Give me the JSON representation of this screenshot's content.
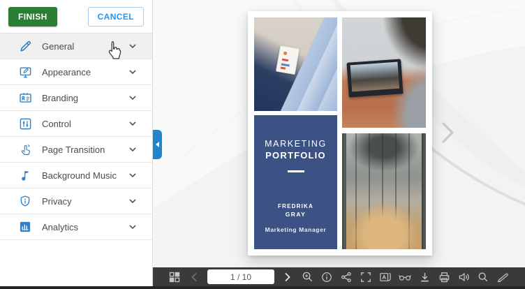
{
  "header": {
    "finish_label": "FINISH",
    "cancel_label": "CANCEL"
  },
  "sidebar": {
    "items": [
      {
        "label": "General",
        "icon": "pencil-icon",
        "active": true
      },
      {
        "label": "Appearance",
        "icon": "monitor-edit-icon",
        "active": false
      },
      {
        "label": "Branding",
        "icon": "id-card-icon",
        "active": false
      },
      {
        "label": "Control",
        "icon": "sliders-icon",
        "active": false
      },
      {
        "label": "Page Transition",
        "icon": "tap-gesture-icon",
        "active": false
      },
      {
        "label": "Background Music",
        "icon": "music-note-icon",
        "active": false
      },
      {
        "label": "Privacy",
        "icon": "shield-info-icon",
        "active": false
      },
      {
        "label": "Analytics",
        "icon": "bar-chart-icon",
        "active": false
      }
    ]
  },
  "viewer": {
    "cover": {
      "title_line1": "MARKETING",
      "title_line2": "PORTFOLIO",
      "author_first": "FREDRIKA",
      "author_last": "GRAY",
      "author_role": "Marketing Manager"
    }
  },
  "toolbar": {
    "page_indicator": "1 / 10",
    "icons": [
      "thumbnails-icon",
      "prev-page-icon",
      "next-page-icon",
      "zoom-in-icon",
      "info-icon",
      "share-icon",
      "fullscreen-icon",
      "text-book-icon",
      "glasses-icon",
      "download-icon",
      "print-icon",
      "sound-icon",
      "search-icon",
      "annotate-icon"
    ]
  },
  "colors": {
    "finish_green": "#2b7d33",
    "cancel_blue": "#2196f3",
    "sidebar_icon_blue": "#3381c5",
    "collapse_tab_blue": "#2285cc",
    "cover_panel_navy": "#3c5285",
    "toolbar_bg": "#3a3a3a"
  }
}
